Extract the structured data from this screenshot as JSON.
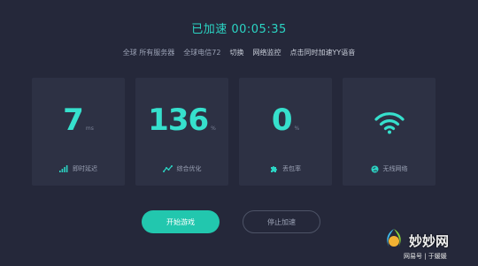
{
  "header": {
    "status": "已加速 00:05:35"
  },
  "server_bar": {
    "region": "全球 所有服务器",
    "server": "全球电信72",
    "switch_label": "切换",
    "monitor_label": "网络监控",
    "voice_label": "点击同时加速YY语音"
  },
  "cards": [
    {
      "value": "7",
      "unit": "ms",
      "label": "即时延迟",
      "icon": "signal-bars-icon"
    },
    {
      "value": "136",
      "unit": "%",
      "label": "综合优化",
      "icon": "trend-line-icon"
    },
    {
      "value": "0",
      "unit": "%",
      "label": "丢包率",
      "icon": "puzzle-icon"
    },
    {
      "value": "",
      "unit": "",
      "label": "无线网络",
      "icon": "wifi-icon"
    }
  ],
  "actions": {
    "start_label": "开始游戏",
    "stop_label": "停止加速"
  },
  "watermark": {
    "brand": "妙妙网",
    "sub": "网易号 | 于媛媛"
  },
  "colors": {
    "accent": "#2bd5c4",
    "background": "#25283a",
    "card": "#2d3144"
  }
}
